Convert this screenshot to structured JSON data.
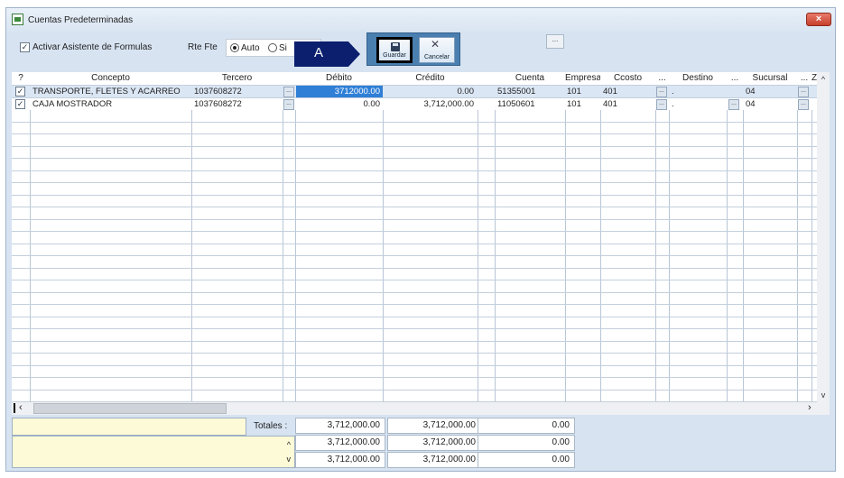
{
  "window": {
    "title": "Cuentas Predeterminadas",
    "close_icon": "close-icon"
  },
  "toolbar": {
    "formula_assistant_label": "Activar Asistente de Formulas",
    "formula_assistant_checked": true,
    "rte_fte_label": "Rte Fte",
    "radio_auto": "Auto",
    "radio_si": "Si",
    "callout": "A",
    "save_label": "Guardar",
    "cancel_label": "Cancelar",
    "extra_button": "..."
  },
  "grid": {
    "columns": [
      "?",
      "Concepto",
      "Tercero",
      "",
      "Débito",
      "Crédito",
      "",
      "Cuenta",
      "Empresa",
      "Ccosto",
      "...",
      "Destino",
      "...",
      "Sucursal",
      "...",
      "Z"
    ],
    "rows": [
      {
        "checked": true,
        "concepto": "TRANSPORTE, FLETES Y ACARREO",
        "tercero": "1037608272",
        "debito": "3712000.00",
        "credito": "0.00",
        "cuenta": "51355001",
        "empresa": "101",
        "ccosto": "401",
        "destino": ".",
        "sucursal": "04"
      },
      {
        "checked": true,
        "concepto": "CAJA MOSTRADOR",
        "tercero": "1037608272",
        "debito": "0.00",
        "credito": "3,712,000.00",
        "cuenta": "11050601",
        "empresa": "101",
        "ccosto": "401",
        "destino": ".",
        "sucursal": "04"
      }
    ],
    "cell_button": "..."
  },
  "totals": {
    "label": "Totales :",
    "rows": [
      {
        "debito": "3,712,000.00",
        "credito": "3,712,000.00",
        "diferencia": "0.00"
      },
      {
        "debito": "3,712,000.00",
        "credito": "3,712,000.00",
        "diferencia": "0.00"
      },
      {
        "debito": "3,712,000.00",
        "credito": "3,712,000.00",
        "diferencia": "0.00"
      }
    ]
  },
  "colors": {
    "window_bg": "#d7e3f1",
    "selection": "#2f7fd6",
    "note_bg": "#fdfbd7",
    "button_group": "#4a7fb0",
    "callout": "#0b1f6e"
  }
}
